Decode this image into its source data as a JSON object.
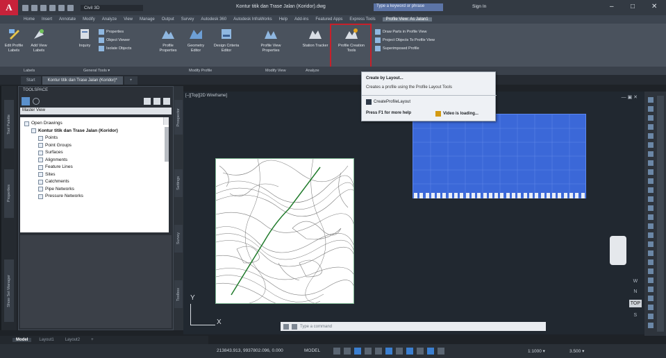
{
  "titlebar": {
    "logo": "A",
    "workspace": "Civil 3D",
    "document_title": "Kontur titik dan Trase Jalan (Koridor).dwg",
    "search_placeholder": "Type a keyword or phrase",
    "sign_in": "Sign In",
    "minimize": "–",
    "maximize": "□",
    "close": "✕"
  },
  "ribbon_tabs": [
    "Home",
    "Insert",
    "Annotate",
    "Modify",
    "Analyze",
    "View",
    "Manage",
    "Output",
    "Survey",
    "Autodesk 360",
    "Autodesk InfraWorks",
    "Help",
    "Add-ins",
    "Featured Apps",
    "Express Tools",
    "Profile View: As Jalan1"
  ],
  "ribbon": {
    "buttons": [
      {
        "label": "Edit Profile Labels",
        "name": "edit-profile-labels-button"
      },
      {
        "label": "Add View Labels",
        "name": "add-view-labels-button"
      },
      {
        "label": "Inquiry",
        "name": "inquiry-button"
      },
      {
        "label": "Profile Properties",
        "name": "profile-properties-button"
      },
      {
        "label": "Geometry Editor",
        "name": "geometry-editor-button"
      },
      {
        "label": "Design Criteria Editor",
        "name": "design-criteria-editor-button"
      },
      {
        "label": "Profile View Properties",
        "name": "profile-view-properties-button"
      },
      {
        "label": "Station Tracker",
        "name": "station-tracker-button"
      },
      {
        "label": "Profile Creation Tools",
        "name": "profile-creation-tools-button"
      }
    ],
    "general_tools": [
      "Properties",
      "Object Viewer",
      "Isolate Objects"
    ],
    "launch_pad": [
      "Draw Parts in Profile View",
      "Project Objects To Profile View",
      "Superimposed Profile"
    ],
    "panels": [
      "Labels",
      "General Tools ▾",
      "Modify Profile",
      "Modify View",
      "Analyze",
      "Launch Pad"
    ]
  },
  "doc_tabs": [
    "Start",
    "Kontur titik dan Trase Jalan (Koridor)*",
    "+"
  ],
  "toolspace": {
    "title": "TOOLSPACE",
    "view_select": "Master View",
    "tree": [
      {
        "label": "Open Drawings",
        "level": 0
      },
      {
        "label": "Kontur titik dan Trase Jalan (Koridor)",
        "level": 1,
        "bold": true
      },
      {
        "label": "Points",
        "level": 2
      },
      {
        "label": "Point Groups",
        "level": 2
      },
      {
        "label": "Surfaces",
        "level": 2
      },
      {
        "label": "Alignments",
        "level": 2
      },
      {
        "label": "Feature Lines",
        "level": 2
      },
      {
        "label": "Sites",
        "level": 2
      },
      {
        "label": "Catchments",
        "level": 2
      },
      {
        "label": "Pipe Networks",
        "level": 2
      },
      {
        "label": "Pressure Networks",
        "level": 2
      }
    ],
    "vertical_tabs": [
      "Tool Palette",
      "Properties",
      "Show Set Manager"
    ],
    "strip_tabs": [
      "Prospector",
      "Settings",
      "Survey",
      "Toolbox"
    ]
  },
  "viewport": {
    "label": "[–][Top][2D Wireframe]",
    "controls": "— ▣ ✕",
    "ucs_x": "X",
    "ucs_y": "Y"
  },
  "navtools": [
    "W",
    "N",
    "TOP",
    "S"
  ],
  "tooltip": {
    "title": "Create by Layout...",
    "description": "Creates a profile using the Profile Layout Tools",
    "command": "CreateProfileLayout",
    "help": "Press F1 for more help",
    "video": "Video is loading..."
  },
  "command_line": {
    "placeholder": "Type a command"
  },
  "layout_tabs": [
    "Model",
    "Layout1",
    "Layout2",
    "+"
  ],
  "status": {
    "coords": "213843.913, 9937802.096, 0.000",
    "model": "MODEL",
    "scale": "1:1000 ▾",
    "scale2": "3.500 ▾"
  },
  "colors": {
    "highlight": "#c8202a",
    "profile_grid": "#3b68d8",
    "alignment": "#1f7a2a",
    "app_red": "#c7223a"
  }
}
